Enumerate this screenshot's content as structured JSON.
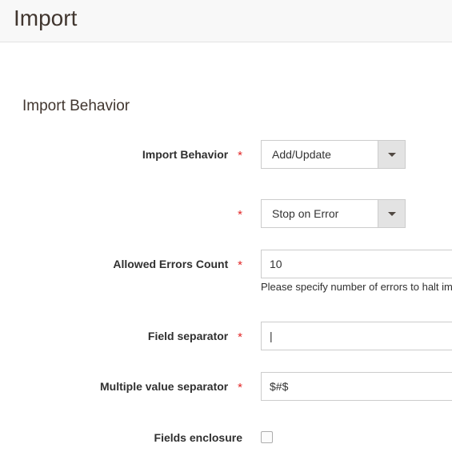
{
  "header": {
    "title": "Import"
  },
  "section": {
    "heading": "Import Behavior"
  },
  "form": {
    "required_marker": "*",
    "rows": [
      {
        "label": "Import Behavior",
        "type": "select",
        "value": "Add/Update",
        "required": true
      },
      {
        "label": "",
        "type": "select",
        "value": "Stop on Error",
        "required": true
      },
      {
        "label": "Allowed Errors Count",
        "type": "text",
        "value": "10",
        "required": true,
        "note": "Please specify number of errors to halt imp"
      },
      {
        "label": "Field separator",
        "type": "text",
        "value": "|",
        "required": true
      },
      {
        "label": "Multiple value separator",
        "type": "text",
        "value": "$#$",
        "required": true
      },
      {
        "label": "Fields enclosure",
        "type": "checkbox",
        "checked": false,
        "required": false
      }
    ]
  },
  "colors": {
    "header_bg": "#f8f8f8",
    "title_text": "#41362f",
    "label_text": "#303030",
    "required_red": "#e22626",
    "input_border": "#cccccc",
    "select_button_bg": "#e3e3e3"
  }
}
